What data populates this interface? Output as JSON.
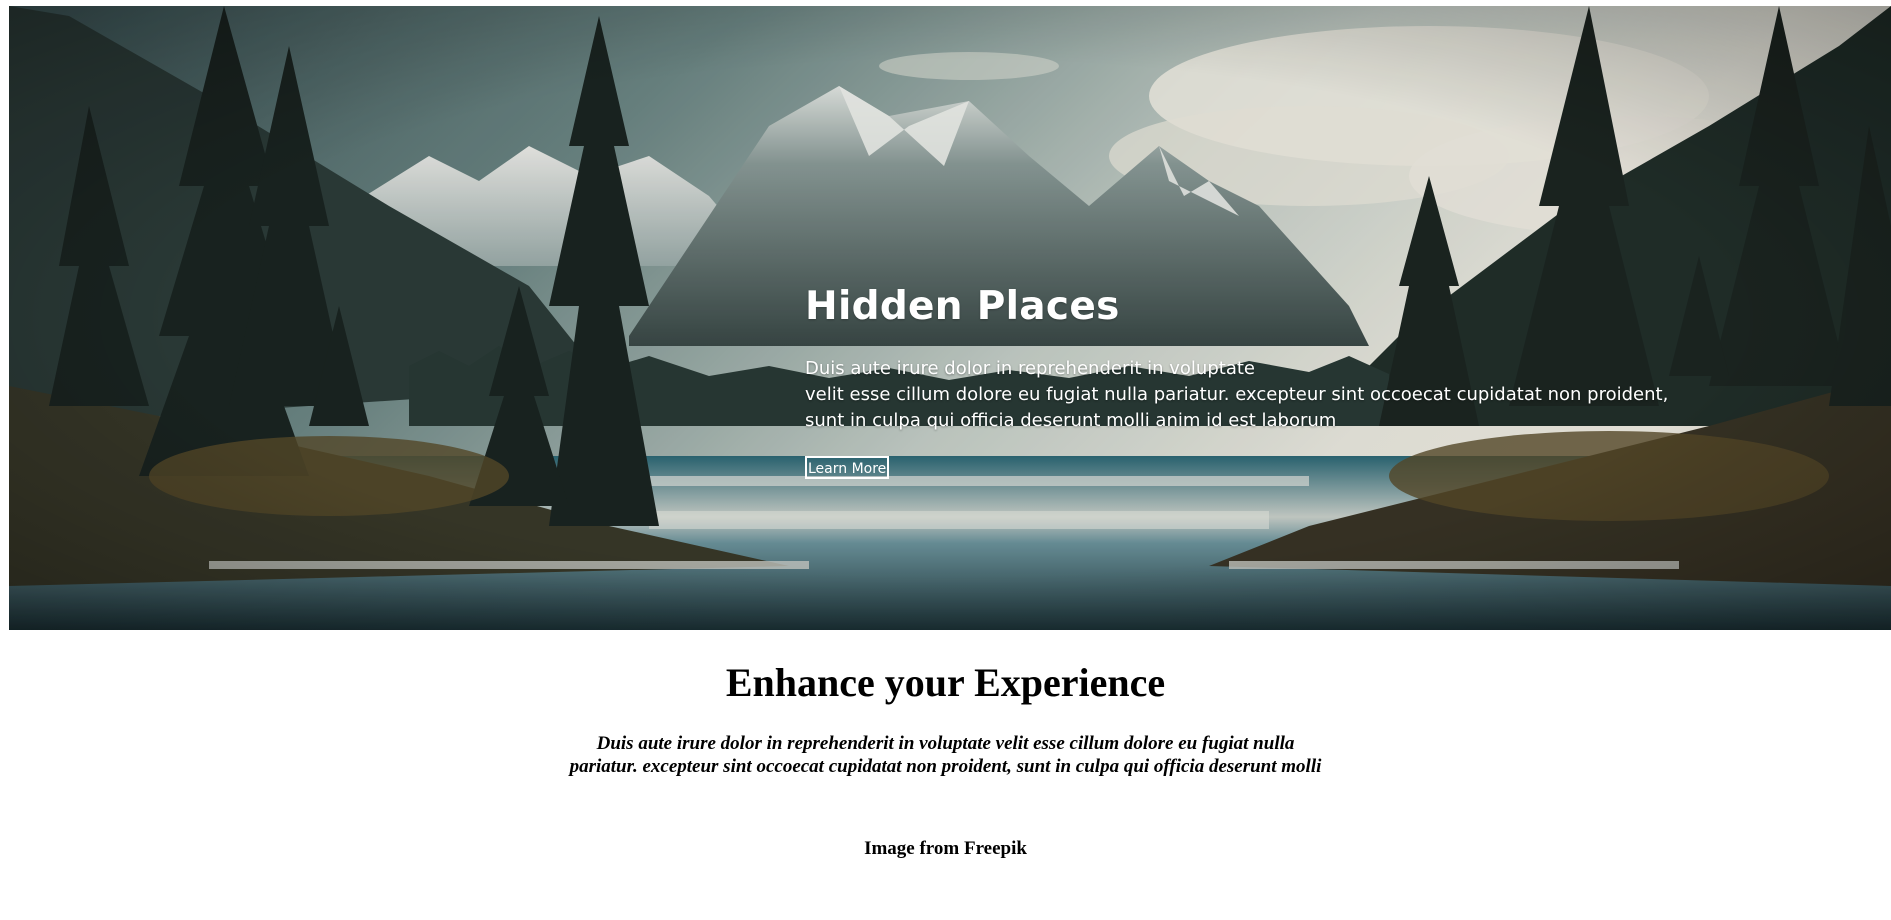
{
  "hero": {
    "title": "Hidden Places",
    "text_lines": [
      "Duis aute irure dolor in reprehenderit in voluptate",
      "velit esse cillum dolore eu fugiat nulla pariatur. excepteur sint occoecat cupidatat non proident,",
      "sunt in culpa qui officia deserunt molli anim id est laborum"
    ],
    "button_label": "Learn More"
  },
  "section": {
    "title": "Enhance your Experience",
    "text": "Duis aute irure dolor in reprehenderit in voluptate velit esse cillum dolore eu fugiat nulla pariatur. excepteur sint occoecat cupidatat non proident, sunt in culpa qui officia deserunt molli"
  },
  "credit": "Image from Freepik"
}
